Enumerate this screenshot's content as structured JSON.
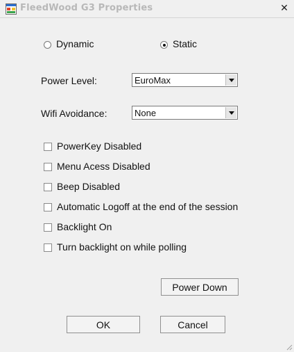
{
  "window": {
    "title": "FleedWood G3 Properties",
    "close_label": "✕",
    "icon": "app-window-icon",
    "title_color": "#b8b8b8"
  },
  "mode": {
    "dynamic_label": "Dynamic",
    "static_label": "Static",
    "selected": "Static"
  },
  "power_level": {
    "label": "Power Level:",
    "value": "EuroMax"
  },
  "wifi_avoidance": {
    "label": "Wifi Avoidance:",
    "value": "None"
  },
  "options": [
    {
      "label": "PowerKey Disabled",
      "checked": false
    },
    {
      "label": "Menu Acess Disabled",
      "checked": false
    },
    {
      "label": "Beep Disabled",
      "checked": false
    },
    {
      "label": "Automatic Logoff at the end of the session",
      "checked": false
    },
    {
      "label": "Backlight On",
      "checked": false
    },
    {
      "label": "Turn backlight on while polling",
      "checked": false
    }
  ],
  "buttons": {
    "power_down": "Power Down",
    "ok": "OK",
    "cancel": "Cancel"
  }
}
